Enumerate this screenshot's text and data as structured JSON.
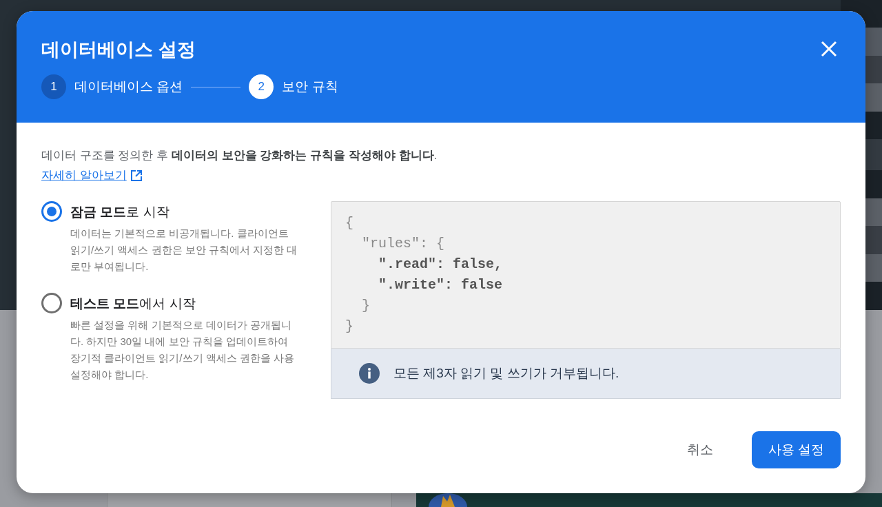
{
  "dialog": {
    "title": "데이터베이스 설정",
    "steps": [
      {
        "number": "1",
        "label": "데이터베이스 옵션",
        "selected": false
      },
      {
        "number": "2",
        "label": "보안 규칙",
        "selected": true
      }
    ],
    "description": "데이터 구조를 정의한 후 **데이터의 보안을 강화하는 규칙을 작성해야 합니다**.",
    "learn_more_link": "자세히 알아보기",
    "options": [
      {
        "title": "**잠금 모드**로 시작",
        "description": "데이터는 기본적으로 비공개됩니다. 클라이언트 읽기/쓰기 액세스 권한은 보안 규칙에서 지정한 대로만 부여됩니다.",
        "selected": true
      },
      {
        "title": "**테스트 모드**에서 시작",
        "description": "빠른 설정을 위해 기본적으로 데이터가 공개됩니다. 하지만 30일 내에 보안 규칙을 업데이트하여 장기적 클라이언트 읽기/쓰기 액세스 권한을 사용 설정해야 합니다.",
        "selected": false
      }
    ],
    "rules_code": [
      {
        "text": "{",
        "kind": "plain"
      },
      {
        "text": "  \"rules\": {",
        "kind": "plain"
      },
      {
        "text": "    \".read\": false,",
        "kind": "bold"
      },
      {
        "text": "    \".write\": false",
        "kind": "bold"
      },
      {
        "text": "  }",
        "kind": "plain"
      },
      {
        "text": "}",
        "kind": "plain"
      }
    ],
    "notice": "모든 제3자 읽기 및 쓰기가 거부됩니다.",
    "buttons": [
      {
        "label": "취소",
        "kind": "text"
      },
      {
        "label": "사용 설정",
        "kind": "primary"
      }
    ]
  }
}
